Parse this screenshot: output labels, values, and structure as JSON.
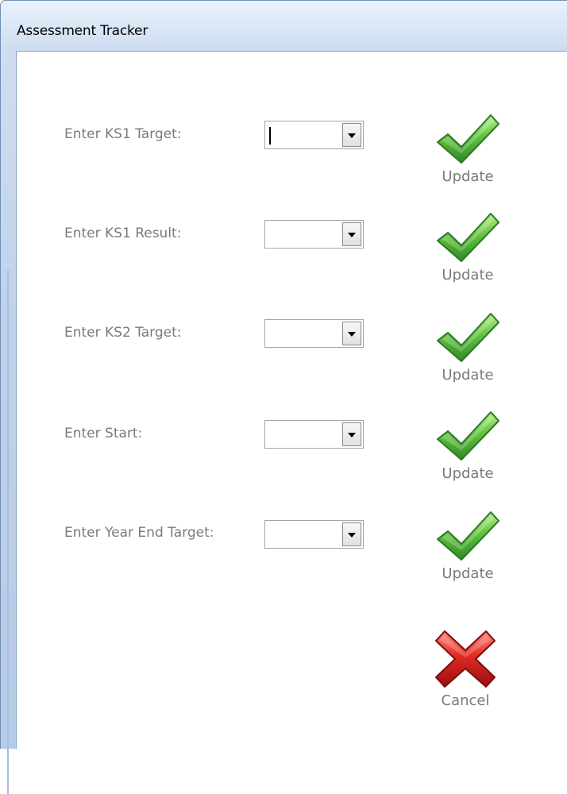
{
  "window": {
    "title": "Assessment Tracker"
  },
  "form": {
    "rows": [
      {
        "label": "Enter KS1 Target:",
        "value": "",
        "action_label": "Update"
      },
      {
        "label": "Enter KS1 Result:",
        "value": "",
        "action_label": "Update"
      },
      {
        "label": "Enter KS2 Target:",
        "value": "",
        "action_label": "Update"
      },
      {
        "label": "Enter Start:",
        "value": "",
        "action_label": "Update"
      },
      {
        "label": "Enter Year End Target:",
        "value": "",
        "action_label": "Update"
      }
    ],
    "cancel_label": "Cancel"
  },
  "icons": {
    "update": "checkmark-icon",
    "cancel": "red-x-icon",
    "dropdown": "dropdown-arrow-icon"
  },
  "colors": {
    "label_text": "#7a7a7a",
    "check_green": "#43a83a",
    "cancel_red": "#cc1b1b",
    "title_bar": "#d9e6f6"
  }
}
